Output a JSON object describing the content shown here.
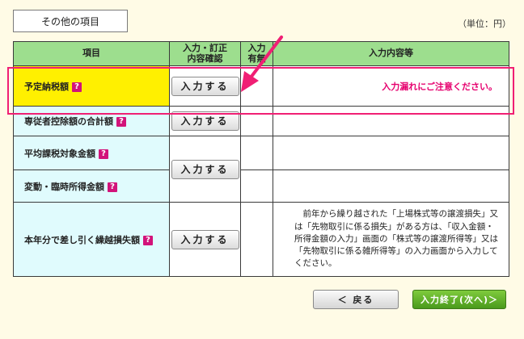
{
  "section_title": "その他の項目",
  "unit": "（単位：円）",
  "table": {
    "headers": {
      "item": "項目",
      "confirm_line1": "入力・訂正",
      "confirm_line2": "内容確認",
      "status_line1": "入力",
      "status_line2": "有無",
      "content": "入力内容等"
    },
    "rows": [
      {
        "label": "予定納税額",
        "button": "入力する",
        "content": "入力漏れにご注意ください。"
      },
      {
        "label": "専従者控除額の合計額",
        "button": "入力する"
      },
      {
        "label": "平均課税対象金額",
        "button": "入力する"
      },
      {
        "label": "変動・臨時所得金額"
      },
      {
        "label": "本年分で差し引く繰越損失額",
        "button": "入力する",
        "content": "前年から繰り越された「上場株式等の譲渡損失」又は「先物取引に係る損失」がある方は、「収入金額・所得金額の入力」画面の「株式等の譲渡所得等」又は「先物取引に係る雑所得等」の入力画面から入力してください。"
      }
    ]
  },
  "help_icon": "?",
  "nav": {
    "back": "＜ 戻る",
    "next": "入力終了(次へ)＞"
  },
  "colors": {
    "highlight_row": "#fff000",
    "label_bg": "#e0fbfd",
    "header_bg": "#9dde8e",
    "callout": "#f01f74",
    "warning_text": "#e6006e",
    "next_button": "#5aaa25"
  }
}
